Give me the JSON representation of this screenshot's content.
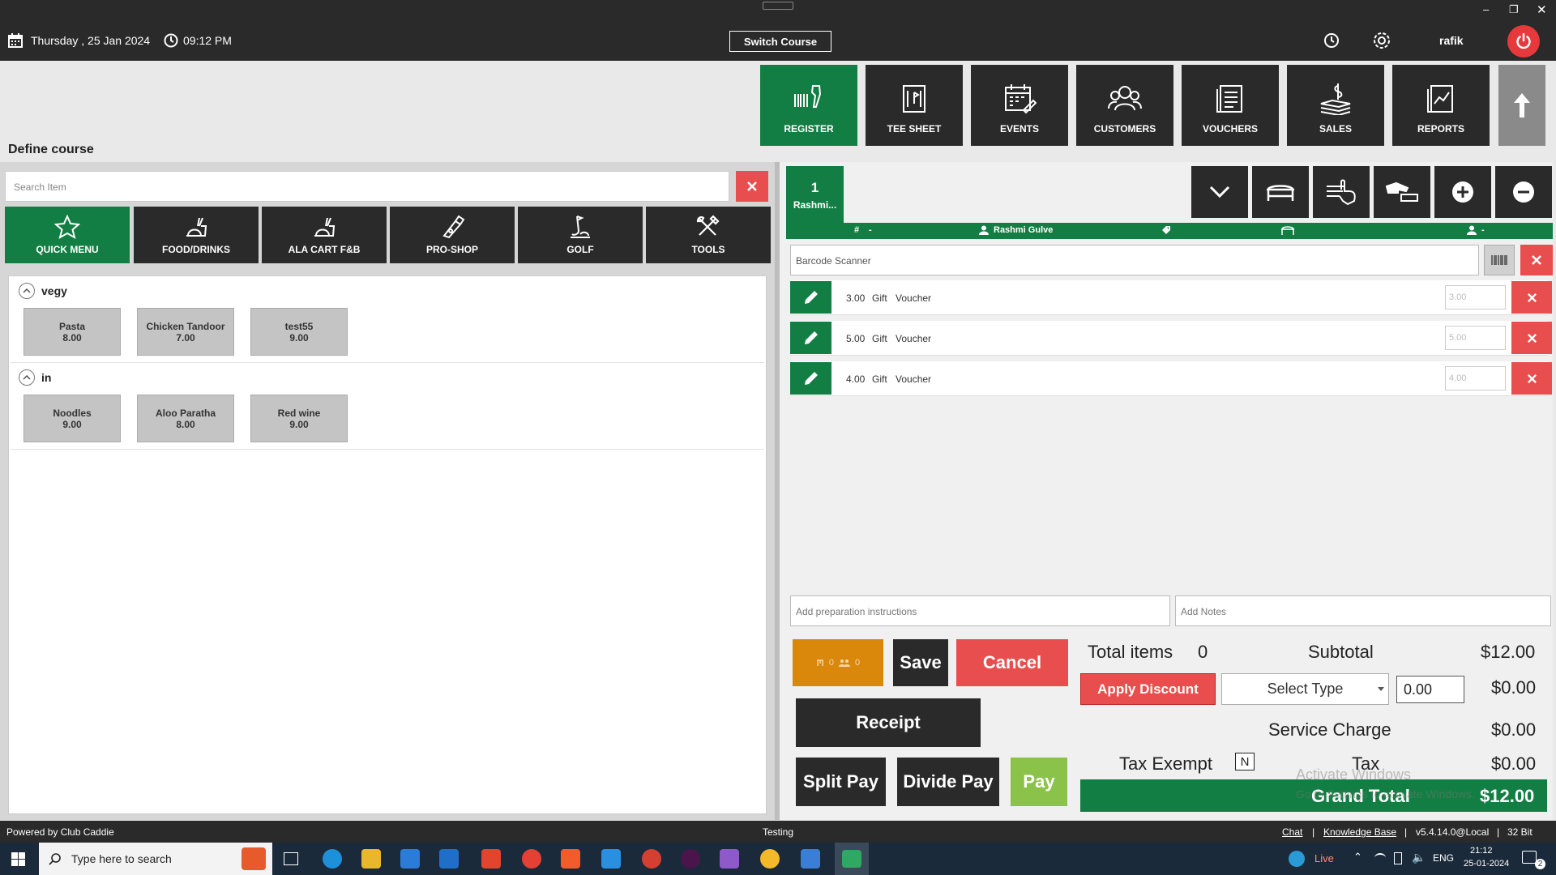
{
  "topbar": {
    "date": "Thursday ,  25 Jan 2024",
    "time": "09:12 PM",
    "switch_course": "Switch Course",
    "user": "rafik"
  },
  "nav": [
    {
      "label": "REGISTER",
      "icon": "register-icon"
    },
    {
      "label": "TEE SHEET",
      "icon": "tee-sheet-icon"
    },
    {
      "label": "EVENTS",
      "icon": "events-icon"
    },
    {
      "label": "CUSTOMERS",
      "icon": "customers-icon"
    },
    {
      "label": "VOUCHERS",
      "icon": "vouchers-icon"
    },
    {
      "label": "SALES",
      "icon": "sales-icon"
    },
    {
      "label": "REPORTS",
      "icon": "reports-icon"
    }
  ],
  "page_title": "Define course",
  "search": {
    "placeholder": "Search Item"
  },
  "categories": [
    {
      "label": "QUICK MENU"
    },
    {
      "label": "FOOD/DRINKS"
    },
    {
      "label": "ALA CART F&B"
    },
    {
      "label": "PRO-SHOP"
    },
    {
      "label": "GOLF"
    },
    {
      "label": "TOOLS"
    }
  ],
  "groups": [
    {
      "name": "vegy",
      "items": [
        {
          "name": "Pasta",
          "price": "8.00"
        },
        {
          "name": "Chicken Tandoor",
          "price": "7.00"
        },
        {
          "name": "test55",
          "price": "9.00"
        }
      ]
    },
    {
      "name": "in",
      "items": [
        {
          "name": "Noodles",
          "price": "9.00"
        },
        {
          "name": "Aloo Paratha",
          "price": "8.00"
        },
        {
          "name": "Red wine",
          "price": "9.00"
        }
      ]
    }
  ],
  "customer_tab": {
    "number": "1",
    "name": "Rashmi..."
  },
  "info_strip": {
    "hash": "-",
    "customer": "Rashmi Gulve",
    "player": "-"
  },
  "barcode": {
    "placeholder": "Barcode Scanner"
  },
  "order_rows": [
    {
      "amount": "3.00",
      "type": "Gift",
      "name": "Voucher",
      "input": "3.00"
    },
    {
      "amount": "5.00",
      "type": "Gift",
      "name": "Voucher",
      "input": "5.00"
    },
    {
      "amount": "4.00",
      "type": "Gift",
      "name": "Voucher",
      "input": "4.00"
    }
  ],
  "notes": {
    "prep_placeholder": "Add preparation instructions",
    "notes_placeholder": "Add Notes"
  },
  "counter": {
    "a": "0",
    "b": "0"
  },
  "actions": {
    "save": "Save",
    "cancel": "Cancel",
    "receipt": "Receipt",
    "split_pay": "Split Pay",
    "divide_pay": "Divide Pay",
    "pay": "Pay"
  },
  "totals": {
    "total_items_label": "Total items",
    "total_items": "0",
    "subtotal_label": "Subtotal",
    "subtotal": "$12.00",
    "apply_discount": "Apply Discount",
    "select_type": "Select Type",
    "discount_input": "0.00",
    "discount_value": "$0.00",
    "service_charge_label": "Service Charge",
    "service_charge": "$0.00",
    "tax_exempt_label": "Tax Exempt",
    "tax_exempt_value": "N",
    "tax_label": "Tax",
    "tax": "$0.00",
    "grand_total_label": "Grand Total",
    "grand_total": "$12.00"
  },
  "watermark": {
    "line1": "Activate Windows",
    "line2": "Go to Settings to activate Windows."
  },
  "statusbar": {
    "powered": "Powered by Club Caddie",
    "center": "Testing",
    "chat": "Chat",
    "kb": "Knowledge Base",
    "version": "v5.4.14.0@Local",
    "bits": "32 Bit",
    "sep": "|"
  },
  "taskbar": {
    "search": "Type here to search",
    "live": "Live",
    "lang": "ENG",
    "time": "21:12",
    "date": "25-01-2024",
    "notif": "2"
  },
  "colors": {
    "green": "#137e43",
    "red": "#e94e4e",
    "dark": "#2a2a2a",
    "orange": "#d9880c",
    "pay": "#8bc34a"
  }
}
